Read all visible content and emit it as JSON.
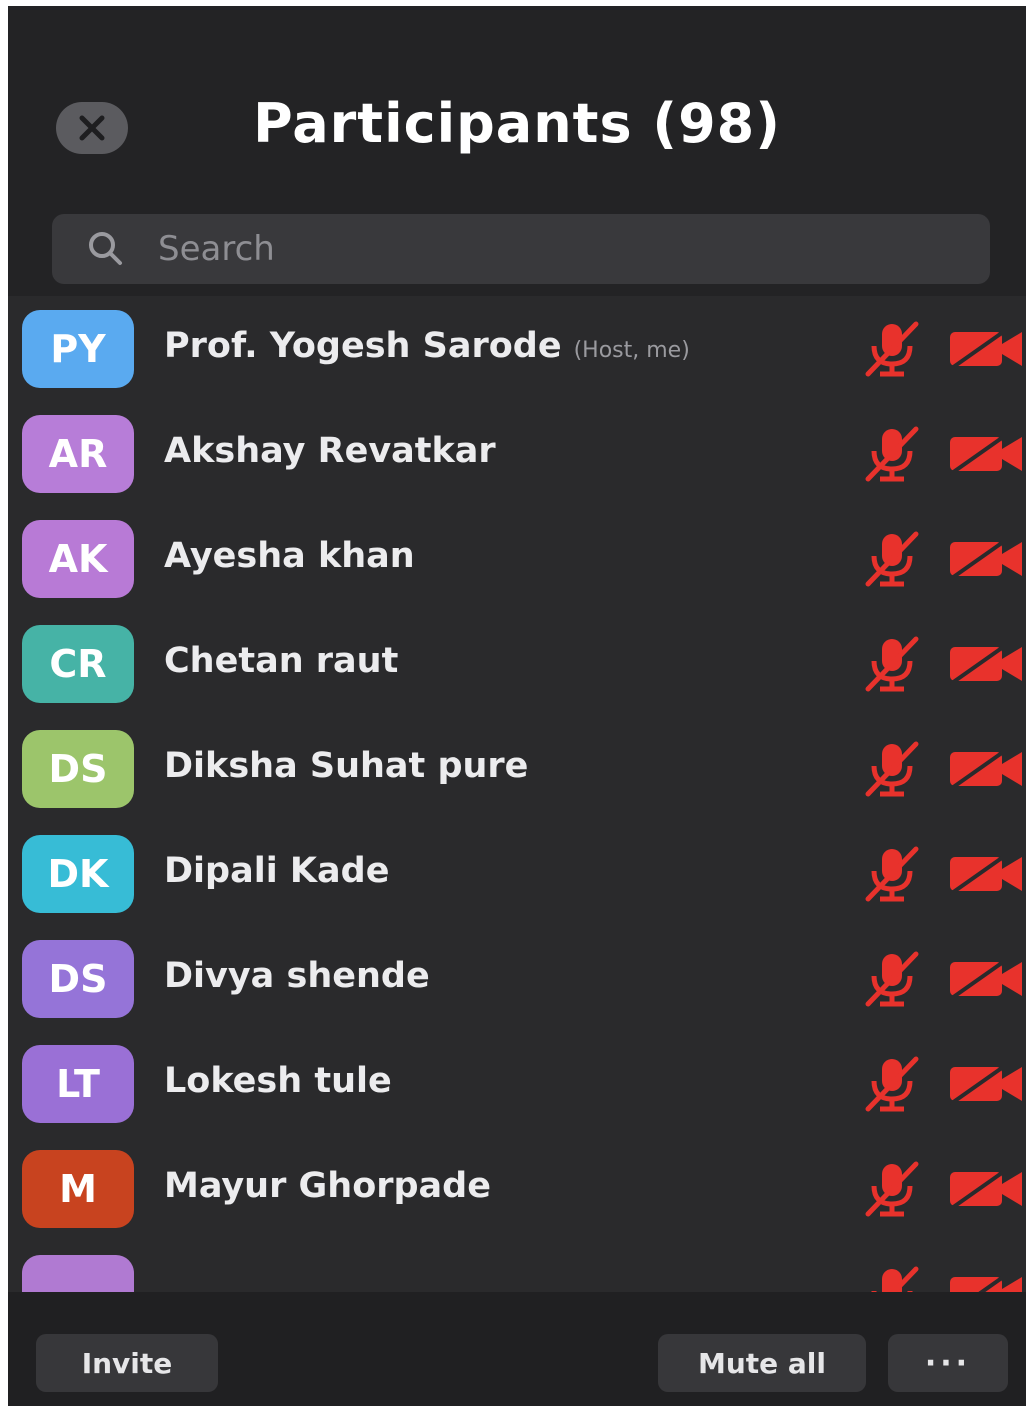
{
  "header": {
    "title": "Participants (98)"
  },
  "search": {
    "placeholder": "Search"
  },
  "colors": {
    "muted_red": "#e8322c"
  },
  "participants": [
    {
      "initials": "PY",
      "name": "Prof. Yogesh Sarode",
      "role": "(Host, me)",
      "avatar_color": "#5aaaf0",
      "mic": "muted",
      "video": "off"
    },
    {
      "initials": "AR",
      "name": "Akshay Revatkar",
      "role": "",
      "avatar_color": "#b77dd8",
      "mic": "muted",
      "video": "off"
    },
    {
      "initials": "AK",
      "name": "Ayesha khan",
      "role": "",
      "avatar_color": "#b87ad6",
      "mic": "muted",
      "video": "off"
    },
    {
      "initials": "CR",
      "name": "Chetan raut",
      "role": "",
      "avatar_color": "#46b3a6",
      "mic": "muted",
      "video": "off"
    },
    {
      "initials": "DS",
      "name": "Diksha Suhat pure",
      "role": "",
      "avatar_color": "#9cc56b",
      "mic": "muted",
      "video": "off"
    },
    {
      "initials": "DK",
      "name": "Dipali Kade",
      "role": "",
      "avatar_color": "#37bcd6",
      "mic": "muted",
      "video": "off"
    },
    {
      "initials": "DS",
      "name": "Divya shende",
      "role": "",
      "avatar_color": "#9574d8",
      "mic": "muted",
      "video": "off"
    },
    {
      "initials": "LT",
      "name": "Lokesh tule",
      "role": "",
      "avatar_color": "#9a70d6",
      "mic": "muted",
      "video": "off"
    },
    {
      "initials": "M",
      "name": "Mayur Ghorpade",
      "role": "",
      "avatar_color": "#c8431f",
      "mic": "muted",
      "video": "off"
    },
    {
      "initials": "",
      "name": "",
      "role": "",
      "avatar_color": "#b07ad2",
      "mic": "muted",
      "video": "off"
    }
  ],
  "footer": {
    "invite_label": "Invite",
    "mute_all_label": "Mute all",
    "more_label": "···"
  }
}
